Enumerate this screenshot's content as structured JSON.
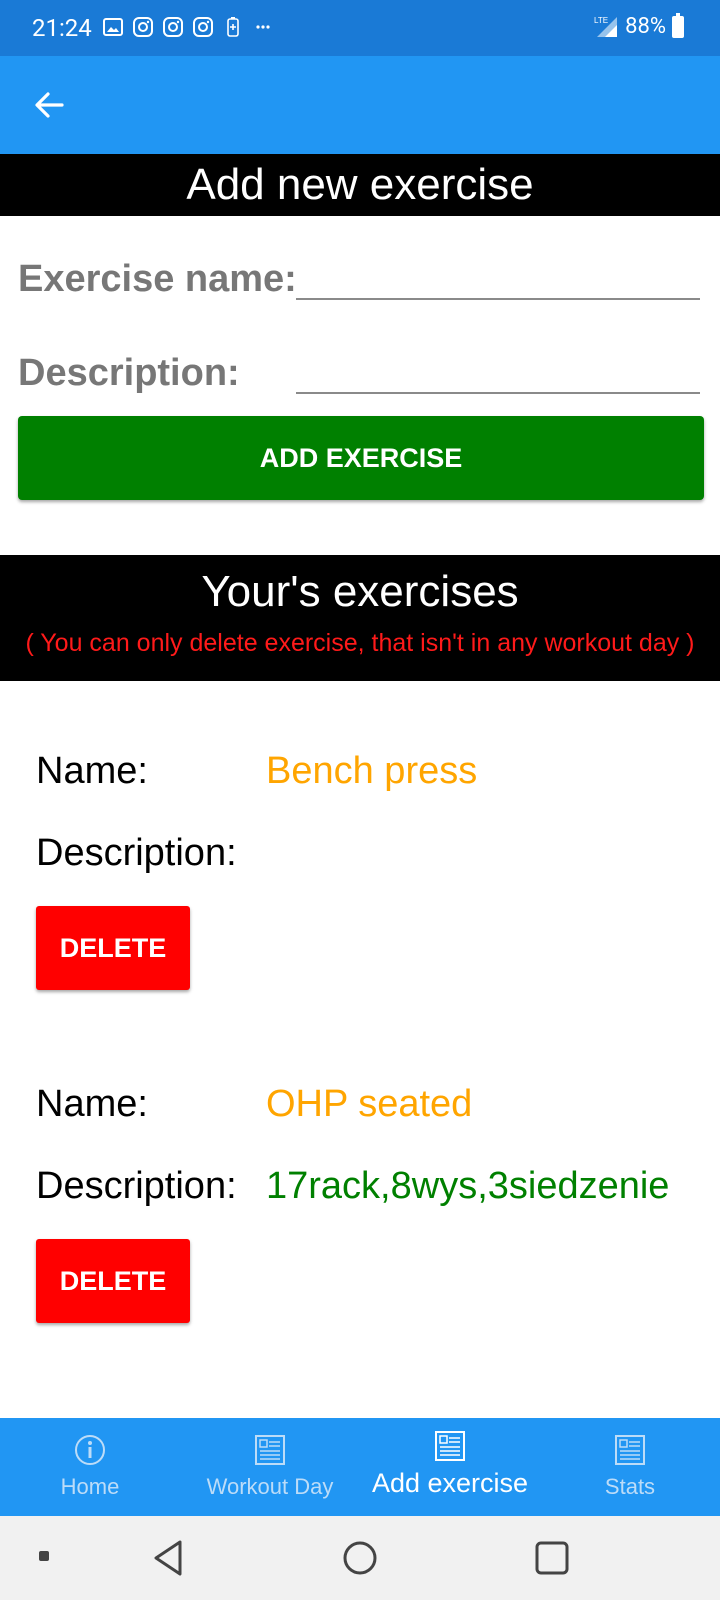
{
  "status_bar": {
    "time": "21:24",
    "network": "LTE",
    "battery": "88%"
  },
  "add_section": {
    "title": "Add new exercise",
    "name_label": "Exercise name:",
    "name_value": "",
    "description_label": "Description:",
    "description_value": "",
    "button_label": "ADD EXERCISE"
  },
  "list_section": {
    "title": "Your's exercises",
    "note": "( You can only delete exercise, that isn't in any workout day )"
  },
  "exercises": [
    {
      "name_label": "Name:",
      "name": "Bench press",
      "description_label": "Description:",
      "description": "",
      "delete_label": "DELETE"
    },
    {
      "name_label": "Name:",
      "name": "OHP seated",
      "description_label": "Description:",
      "description": "17rack,8wys,3siedzenie",
      "delete_label": "DELETE"
    }
  ],
  "bottom_nav": [
    {
      "label": "Home",
      "icon": "info-icon",
      "active": false
    },
    {
      "label": "Workout Day",
      "icon": "list-icon",
      "active": false
    },
    {
      "label": "Add exercise",
      "icon": "list-icon",
      "active": true
    },
    {
      "label": "Stats",
      "icon": "list-icon",
      "active": false
    }
  ],
  "colors": {
    "app_bar": "#2196f3",
    "status_bar": "#1a7ad6",
    "add_button": "#008000",
    "delete_button": "#ff0000",
    "exercise_name": "#ffa500",
    "exercise_description": "#008000",
    "note": "#ff1a1a"
  }
}
